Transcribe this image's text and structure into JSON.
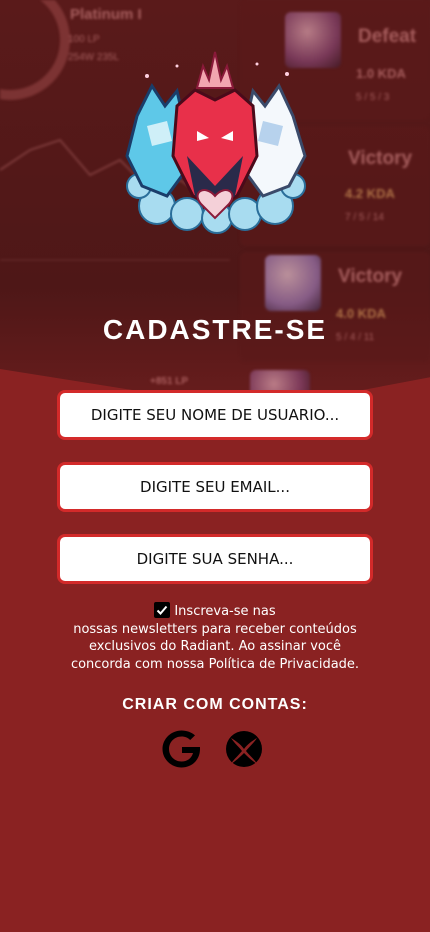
{
  "background": {
    "profile_rank": "Platinum I",
    "profile_lp": "100 LP",
    "profile_record": "254W 235L",
    "matches": [
      {
        "result": "Defeat",
        "kda": "1.0 KDA",
        "score": "5 / 5 / 3"
      },
      {
        "result": "Victory",
        "kda": "4.2 KDA",
        "score": "7 / 5 / 14"
      },
      {
        "result": "Victory",
        "kda": "4.0 KDA",
        "score": "5 / 4 / 11"
      }
    ],
    "lp_gain": "+851 LP"
  },
  "form": {
    "title": "CADASTRE-SE",
    "username_placeholder": "DIGITE SEU NOME DE USUARIO...",
    "email_placeholder": "DIGITE SEU EMAIL...",
    "password_placeholder": "DIGITE SUA SENHA...",
    "newsletter_checked": true,
    "newsletter_line1": "Inscreva-se nas",
    "newsletter_line2": "nossas newsletters para receber conteúdos",
    "newsletter_line3": "exclusivos do Radiant. Ao assinar você",
    "newsletter_line4": "concorda com nossa Política de Privacidade."
  },
  "social": {
    "label": "CRIAR COM CONTAS:",
    "providers": [
      "google-icon",
      "xbox-icon"
    ]
  },
  "colors": {
    "background": "#8a2222",
    "field_border": "#d32a2a"
  }
}
